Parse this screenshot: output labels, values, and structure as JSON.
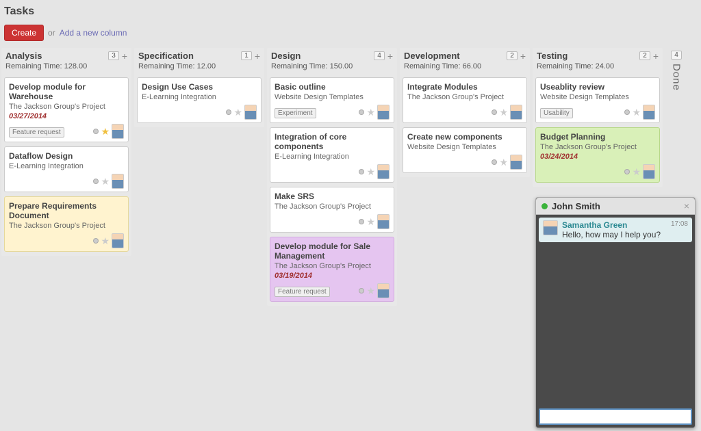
{
  "page_title": "Tasks",
  "toolbar": {
    "create_label": "Create",
    "or_text": "or",
    "add_column_text": "Add a new column"
  },
  "done": {
    "label": "Done",
    "count": "4"
  },
  "columns": [
    {
      "title": "Analysis",
      "count": "3",
      "remaining": "Remaining Time: 128.00",
      "cards": [
        {
          "title": "Develop module for Warehouse",
          "project": "The Jackson Group's Project",
          "date": "03/27/2014",
          "tag": "Feature request",
          "color": "",
          "star": true
        },
        {
          "title": "Dataflow Design",
          "project": "E-Learning Integration",
          "color": ""
        },
        {
          "title": "Prepare Requirements Document",
          "project": "The Jackson Group's Project",
          "color": "yellow"
        }
      ]
    },
    {
      "title": "Specification",
      "count": "1",
      "remaining": "Remaining Time: 12.00",
      "cards": [
        {
          "title": "Design Use Cases",
          "project": "E-Learning Integration",
          "color": ""
        }
      ]
    },
    {
      "title": "Design",
      "count": "4",
      "remaining": "Remaining Time: 150.00",
      "cards": [
        {
          "title": "Basic outline",
          "project": "Website Design Templates",
          "tag": "Experiment",
          "color": ""
        },
        {
          "title": "Integration of core components",
          "project": "E-Learning Integration",
          "color": ""
        },
        {
          "title": "Make SRS",
          "project": "The Jackson Group's Project",
          "color": ""
        },
        {
          "title": "Develop module for Sale Management",
          "project": "The Jackson Group's Project",
          "date": "03/19/2014",
          "tag": "Feature request",
          "color": "purple"
        }
      ]
    },
    {
      "title": "Development",
      "count": "2",
      "remaining": "Remaining Time: 66.00",
      "cards": [
        {
          "title": "Integrate Modules",
          "project": "The Jackson Group's Project",
          "color": ""
        },
        {
          "title": "Create new components",
          "project": "Website Design Templates",
          "color": ""
        }
      ]
    },
    {
      "title": "Testing",
      "count": "2",
      "remaining": "Remaining Time: 24.00",
      "cards": [
        {
          "title": "Useablity review",
          "project": "Website Design Templates",
          "tag": "Usability",
          "color": ""
        },
        {
          "title": "Budget Planning",
          "project": "The Jackson Group's Project",
          "date": "03/24/2014",
          "color": "green"
        }
      ]
    }
  ],
  "chat": {
    "title": "John Smith",
    "sender": "Samantha Green",
    "message": "Hello, how may I help you?",
    "time": "17:08",
    "input_value": ""
  }
}
